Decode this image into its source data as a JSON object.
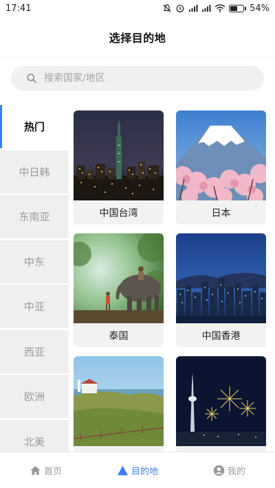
{
  "status_bar": {
    "time": "17:41",
    "battery": "54%"
  },
  "header": {
    "title": "选择目的地"
  },
  "search": {
    "placeholder": "搜索国家/地区"
  },
  "sidebar": {
    "items": [
      {
        "label": "热门",
        "active": true
      },
      {
        "label": "中日韩"
      },
      {
        "label": "东南亚"
      },
      {
        "label": "中东"
      },
      {
        "label": "中亚"
      },
      {
        "label": "西亚"
      },
      {
        "label": "欧洲"
      },
      {
        "label": "北美"
      }
    ]
  },
  "destinations": [
    {
      "label": "中国台湾",
      "image": "taipei-101-night-skyline"
    },
    {
      "label": "日本",
      "image": "mount-fuji-cherry-blossoms"
    },
    {
      "label": "泰国",
      "image": "elephant-with-rider-jungle"
    },
    {
      "label": "中国香港",
      "image": "hong-kong-harbor-skyline"
    },
    {
      "label": "",
      "image": "coastal-lighthouse-meadow"
    },
    {
      "label": "",
      "image": "macau-tower-fireworks"
    }
  ],
  "tabbar": {
    "home": "首页",
    "destination": "目的地",
    "mine": "我的",
    "active_color": "#3b7ff5",
    "inactive_color": "#9a9a9a"
  }
}
